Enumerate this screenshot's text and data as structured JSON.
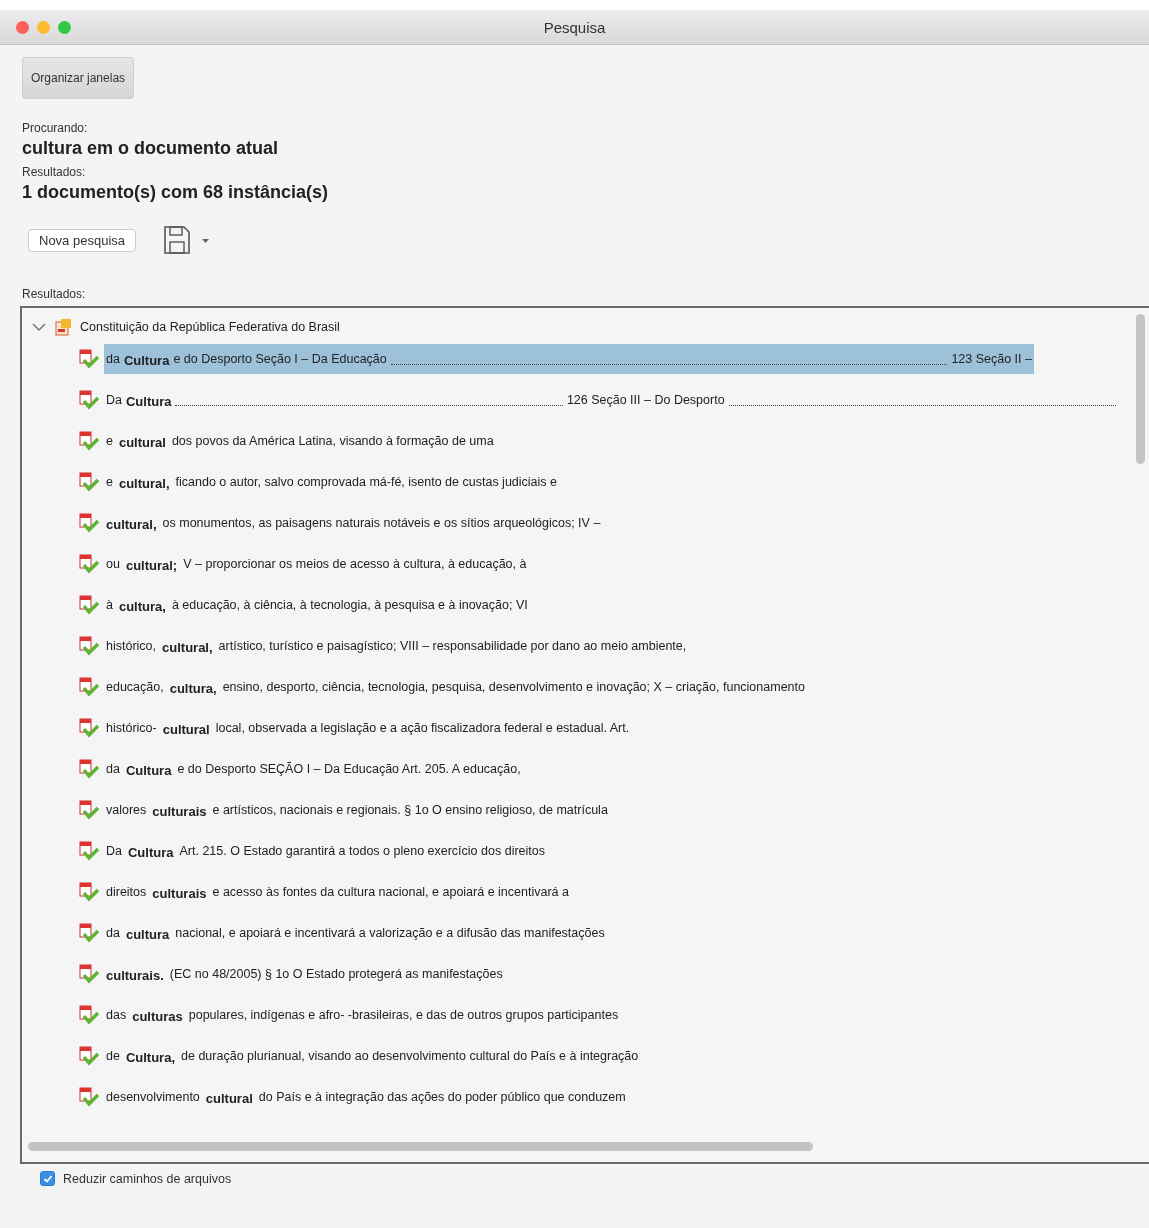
{
  "window": {
    "title": "Pesquisa"
  },
  "arrange_button": "Organizar janelas",
  "searching_label": "Procurando:",
  "searching_value": "cultura em o documento atual",
  "results_label": "Resultados:",
  "results_value": "1 documento(s) com 68 instância(s)",
  "new_search_button": "Nova pesquisa",
  "list_label": "Resultados:",
  "tree": {
    "label": "Constituição da República Federativa do Brasil",
    "expanded": true,
    "children": [
      {
        "before": "da",
        "match": "Cultura",
        "after": "e do Desporto Seção I – Da Educação",
        "tail": "123 Seção II –",
        "trailing_leader": false,
        "selected": true
      },
      {
        "before": "Da",
        "match": "Cultura",
        "tail": "126 Seção III – Do Desporto",
        "trailing_leader": true,
        "selected": false
      },
      {
        "before": "e",
        "match": "cultural",
        "after": "dos povos da América Latina, visando à formação de uma",
        "selected": false
      },
      {
        "before": "e",
        "match": "cultural,",
        "after": "ficando o autor, salvo comprovada má-fé, isento de custas judiciais e",
        "selected": false
      },
      {
        "match": "cultural,",
        "after": "os monumentos, as paisagens naturais notáveis e os sítios arqueológicos; IV –",
        "selected": false
      },
      {
        "before": "ou",
        "match": "cultural;",
        "after": "V – proporcionar os meios de acesso à cultura, à educação, à",
        "selected": false
      },
      {
        "before": "à",
        "match": "cultura,",
        "after": "à educação, à ciência, à tecnologia, à pesquisa e à inovação; VI",
        "selected": false
      },
      {
        "before": "histórico,",
        "match": "cultural,",
        "after": "artístico, turístico e paisagístico; VIII – responsabilidade por dano ao meio ambiente,",
        "selected": false
      },
      {
        "before": "educação,",
        "match": "cultura,",
        "after": "ensino, desporto, ciência, tecnologia, pesquisa, desenvolvimento e inovação; X – criação, funcionamento",
        "selected": false
      },
      {
        "before": "histórico-",
        "match": "cultural",
        "after": "local, observada a legislação e a ação fiscalizadora federal e estadual. Art.",
        "selected": false
      },
      {
        "before": "da",
        "match": "Cultura",
        "after": "e do Desporto SEÇÃO I – Da Educação Art. 205. A educação,",
        "selected": false
      },
      {
        "before": "valores",
        "match": "culturais",
        "after": "e artísticos, nacionais e regionais. § 1o O ensino religioso, de matrícula",
        "selected": false
      },
      {
        "before": "Da",
        "match": "Cultura",
        "after": "Art. 215. O Estado garantirá a todos o pleno exercício dos direitos",
        "selected": false
      },
      {
        "before": "direitos",
        "match": "culturais",
        "after": "e acesso às fontes da cultura nacional, e apoiará e incentivará a",
        "selected": false
      },
      {
        "before": "da",
        "match": "cultura",
        "after": "nacional, e apoiará e incentivará a valorização e a difusão das manifestações",
        "selected": false
      },
      {
        "match": "culturais.",
        "after": "(EC no 48/2005) § 1o O Estado protegerá as manifestações",
        "selected": false
      },
      {
        "before": "das",
        "match": "culturas",
        "after": "populares, indígenas e afro- -brasileiras, e das de outros grupos participantes",
        "selected": false
      },
      {
        "before": "de",
        "match": "Cultura,",
        "after": "de duração plurianual, visando ao desenvolvimento cultural do País e à integração",
        "selected": false
      },
      {
        "before": "desenvolvimento",
        "match": "cultural",
        "after": "do País e à integração das ações do poder público que conduzem",
        "selected": false
      }
    ]
  },
  "shorten_paths": {
    "label": "Reduzir caminhos de arquivos",
    "checked": true
  }
}
